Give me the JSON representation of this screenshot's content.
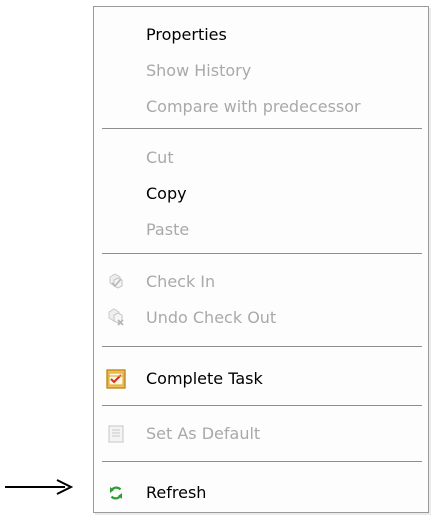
{
  "menu": {
    "items": [
      {
        "label": "Properties",
        "enabled": true,
        "icon": ""
      },
      {
        "label": "Show History",
        "enabled": false,
        "icon": ""
      },
      {
        "label": "Compare with predecessor",
        "enabled": false,
        "icon": ""
      },
      {
        "label": "Cut",
        "enabled": false,
        "icon": ""
      },
      {
        "label": "Copy",
        "enabled": true,
        "icon": ""
      },
      {
        "label": "Paste",
        "enabled": false,
        "icon": ""
      },
      {
        "label": "Check In",
        "enabled": false,
        "icon": "check-in-icon"
      },
      {
        "label": "Undo Check Out",
        "enabled": false,
        "icon": "undo-check-out-icon"
      },
      {
        "label": "Complete Task",
        "enabled": true,
        "icon": "complete-task-icon"
      },
      {
        "label": "Set As Default",
        "enabled": false,
        "icon": "set-as-default-icon"
      },
      {
        "label": "Refresh",
        "enabled": true,
        "icon": "refresh-icon"
      }
    ]
  },
  "pointer": {
    "icon": "right-arrow-icon"
  },
  "colors": {
    "enabled_text": "#000000",
    "disabled_text": "#a9a9a9",
    "border": "#9a9a9a",
    "accent_orange": "#e6a22a",
    "accent_red": "#d42c2c",
    "accent_green": "#2e9e38"
  }
}
